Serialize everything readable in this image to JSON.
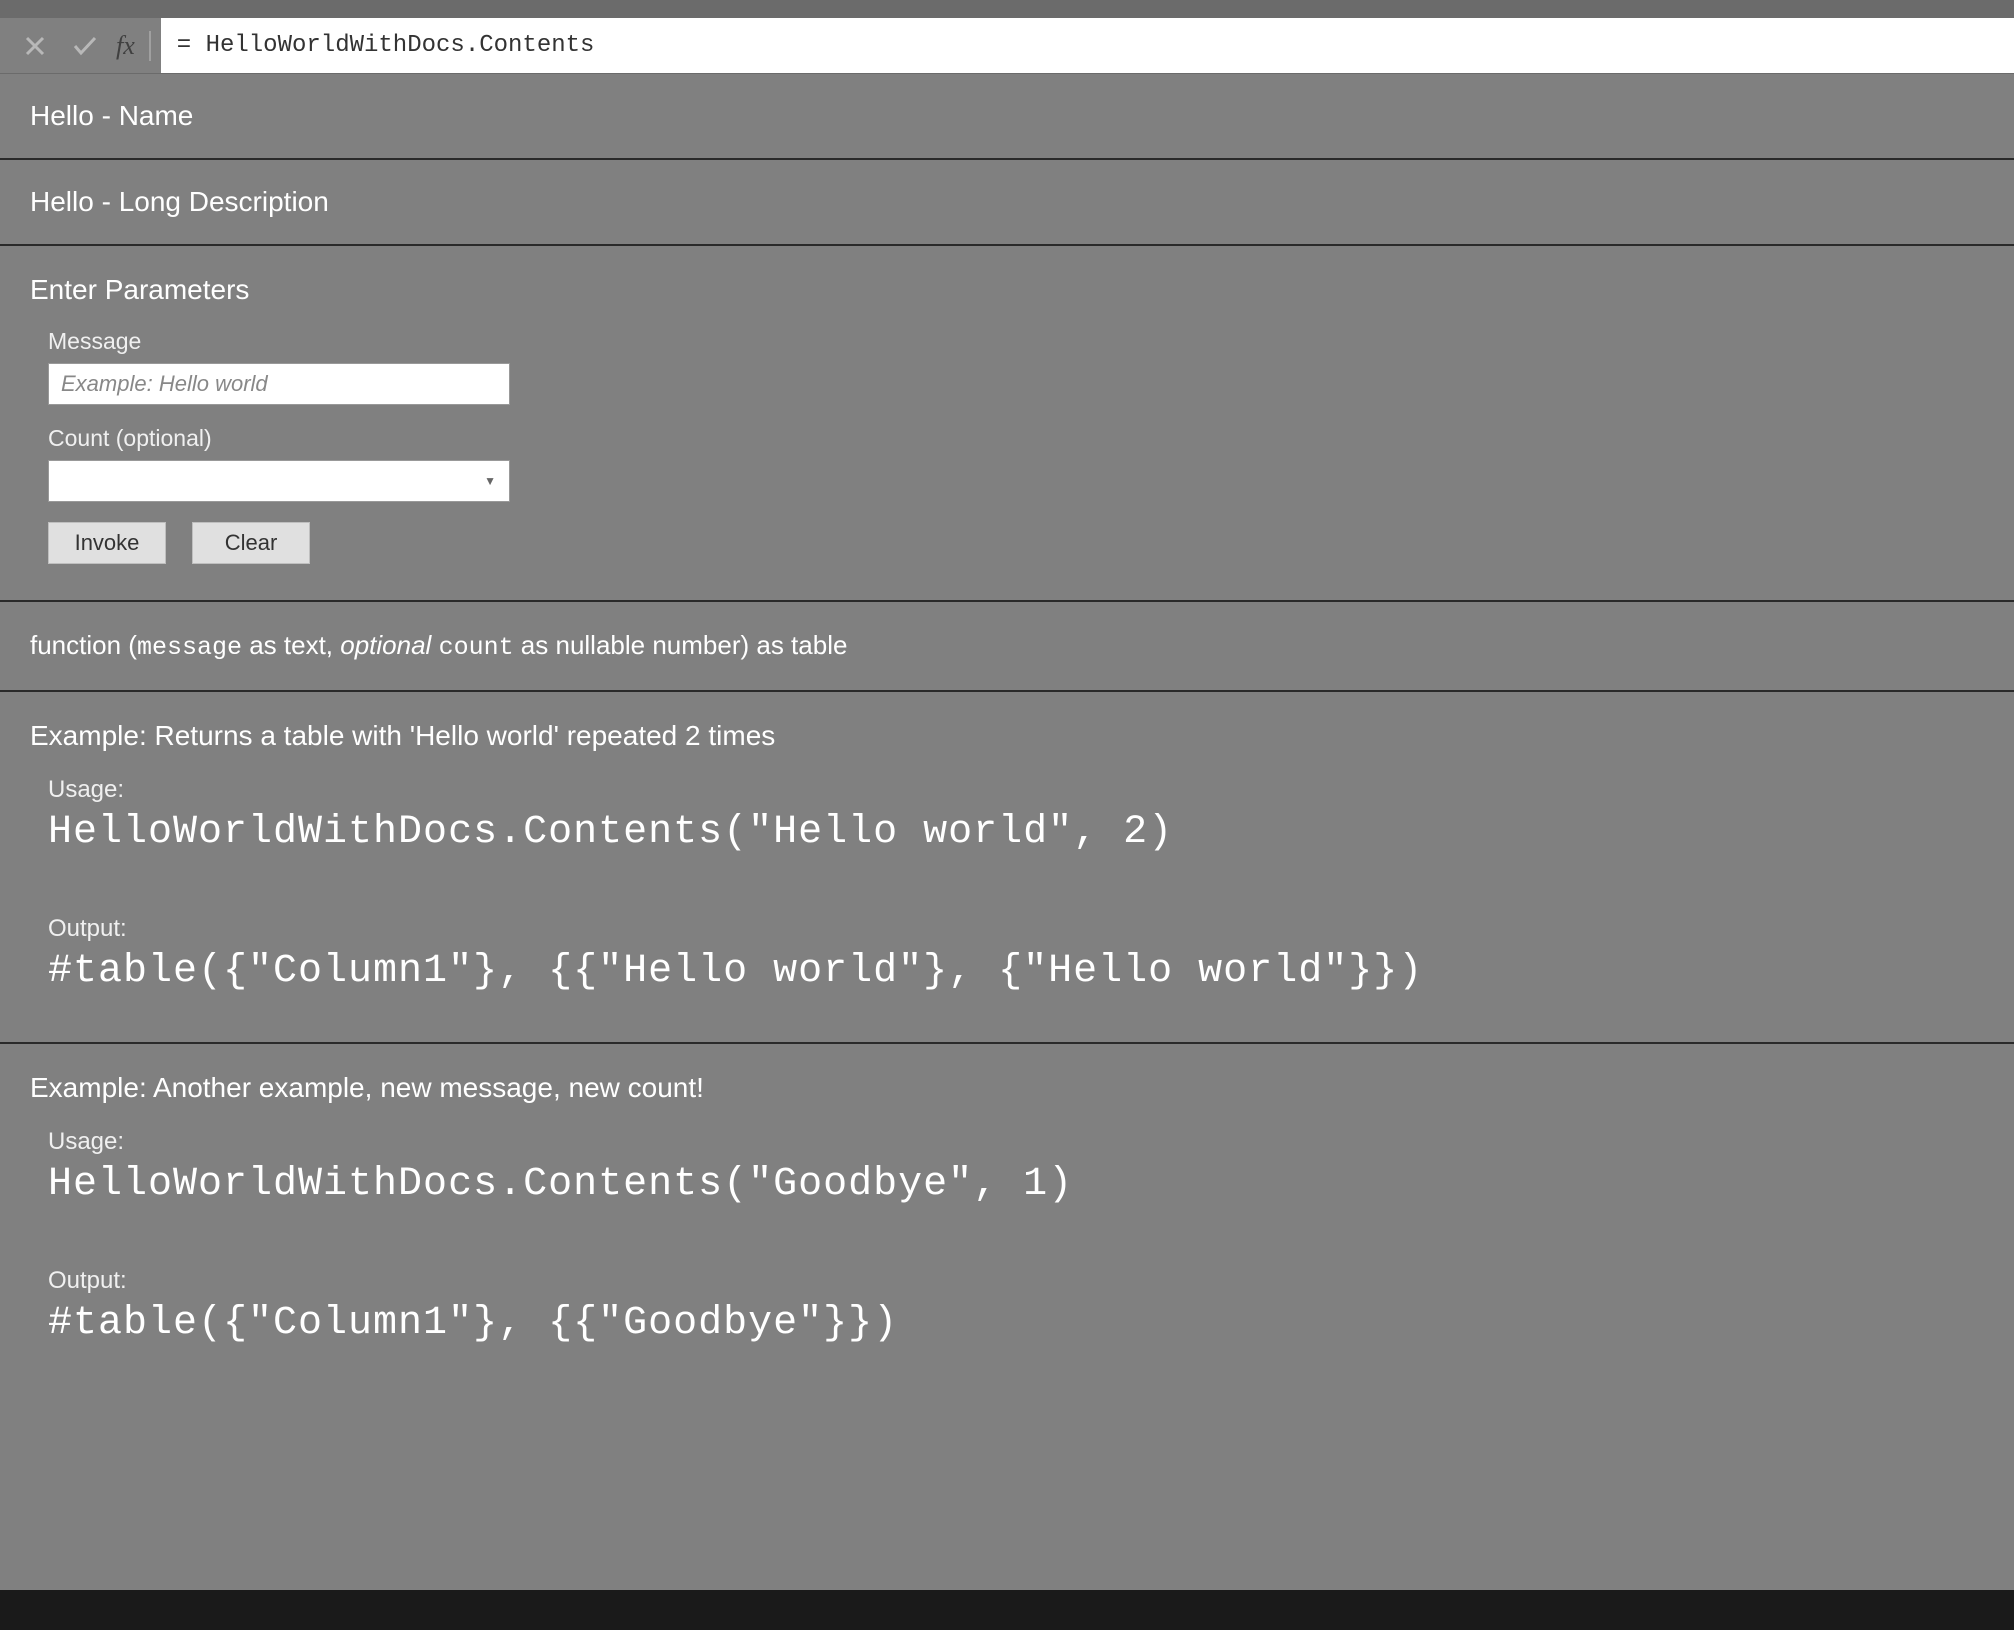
{
  "formula_bar": {
    "fx_label": "fx",
    "value": "= HelloWorldWithDocs.Contents"
  },
  "header": {
    "name": "Hello - Name",
    "long_description": "Hello - Long Description"
  },
  "parameters": {
    "title": "Enter Parameters",
    "fields": {
      "message": {
        "label": "Message",
        "placeholder": "Example: Hello world"
      },
      "count": {
        "label": "Count (optional)",
        "value": ""
      }
    },
    "buttons": {
      "invoke": "Invoke",
      "clear": "Clear"
    }
  },
  "signature": {
    "prefix": "function (",
    "p1_name": "message",
    "p1_type": " as text, ",
    "p2_opt": "optional ",
    "p2_name": "count",
    "p2_type": " as nullable number) as table"
  },
  "examples": [
    {
      "title": "Example: Returns a table with 'Hello world' repeated 2 times",
      "usage_label": "Usage:",
      "usage_code": "HelloWorldWithDocs.Contents(\"Hello world\", 2)",
      "output_label": "Output:",
      "output_code": "#table({\"Column1\"}, {{\"Hello world\"}, {\"Hello world\"}})"
    },
    {
      "title": "Example: Another example, new message, new count!",
      "usage_label": "Usage:",
      "usage_code": "HelloWorldWithDocs.Contents(\"Goodbye\", 1)",
      "output_label": "Output:",
      "output_code": "#table({\"Column1\"}, {{\"Goodbye\"}})"
    }
  ]
}
